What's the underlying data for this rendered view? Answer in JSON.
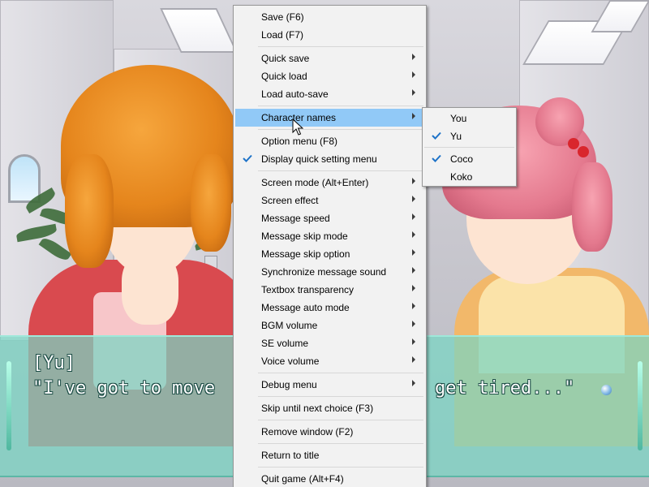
{
  "dialogue": {
    "speaker": "[Yu]",
    "line_visible_left": "\"I've got to move",
    "line_visible_right": "get tired...\""
  },
  "menu": {
    "items": [
      {
        "label": "Save (F6)",
        "submenu": false,
        "checked": false
      },
      {
        "label": "Load (F7)",
        "submenu": false,
        "checked": false
      },
      {
        "label": "Quick save",
        "submenu": true,
        "checked": false
      },
      {
        "label": "Quick load",
        "submenu": true,
        "checked": false
      },
      {
        "label": "Load auto-save",
        "submenu": true,
        "checked": false
      },
      {
        "label": "Character names",
        "submenu": true,
        "checked": false,
        "highlighted": true
      },
      {
        "label": "Option menu (F8)",
        "submenu": false,
        "checked": false
      },
      {
        "label": "Display quick setting menu",
        "submenu": false,
        "checked": true
      },
      {
        "label": "Screen mode (Alt+Enter)",
        "submenu": true,
        "checked": false
      },
      {
        "label": "Screen effect",
        "submenu": true,
        "checked": false
      },
      {
        "label": "Message speed",
        "submenu": true,
        "checked": false
      },
      {
        "label": "Message skip mode",
        "submenu": true,
        "checked": false
      },
      {
        "label": "Message skip option",
        "submenu": true,
        "checked": false
      },
      {
        "label": "Synchronize message sound",
        "submenu": true,
        "checked": false
      },
      {
        "label": "Textbox transparency",
        "submenu": true,
        "checked": false
      },
      {
        "label": "Message auto mode",
        "submenu": true,
        "checked": false
      },
      {
        "label": "BGM volume",
        "submenu": true,
        "checked": false
      },
      {
        "label": "SE volume",
        "submenu": true,
        "checked": false
      },
      {
        "label": "Voice volume",
        "submenu": true,
        "checked": false
      },
      {
        "label": "Debug menu",
        "submenu": true,
        "checked": false
      },
      {
        "label": "Skip until next choice (F3)",
        "submenu": false,
        "checked": false
      },
      {
        "label": "Remove window (F2)",
        "submenu": false,
        "checked": false
      },
      {
        "label": "Return to title",
        "submenu": false,
        "checked": false
      },
      {
        "label": "Quit game (Alt+F4)",
        "submenu": false,
        "checked": false
      }
    ]
  },
  "submenu": {
    "items": [
      {
        "label": "You",
        "checked": false
      },
      {
        "label": "Yu",
        "checked": true
      },
      {
        "label": "Coco",
        "checked": true
      },
      {
        "label": "Koko",
        "checked": false
      }
    ]
  },
  "colors": {
    "menu_bg": "#f2f2f2",
    "highlight": "#91c9f7",
    "check": "#1e73c8",
    "dialogue_box": "#78d6c4"
  },
  "icons": {
    "check": "checkmark-icon",
    "submenu": "chevron-right-icon",
    "cursor": "mouse-pointer-icon"
  }
}
